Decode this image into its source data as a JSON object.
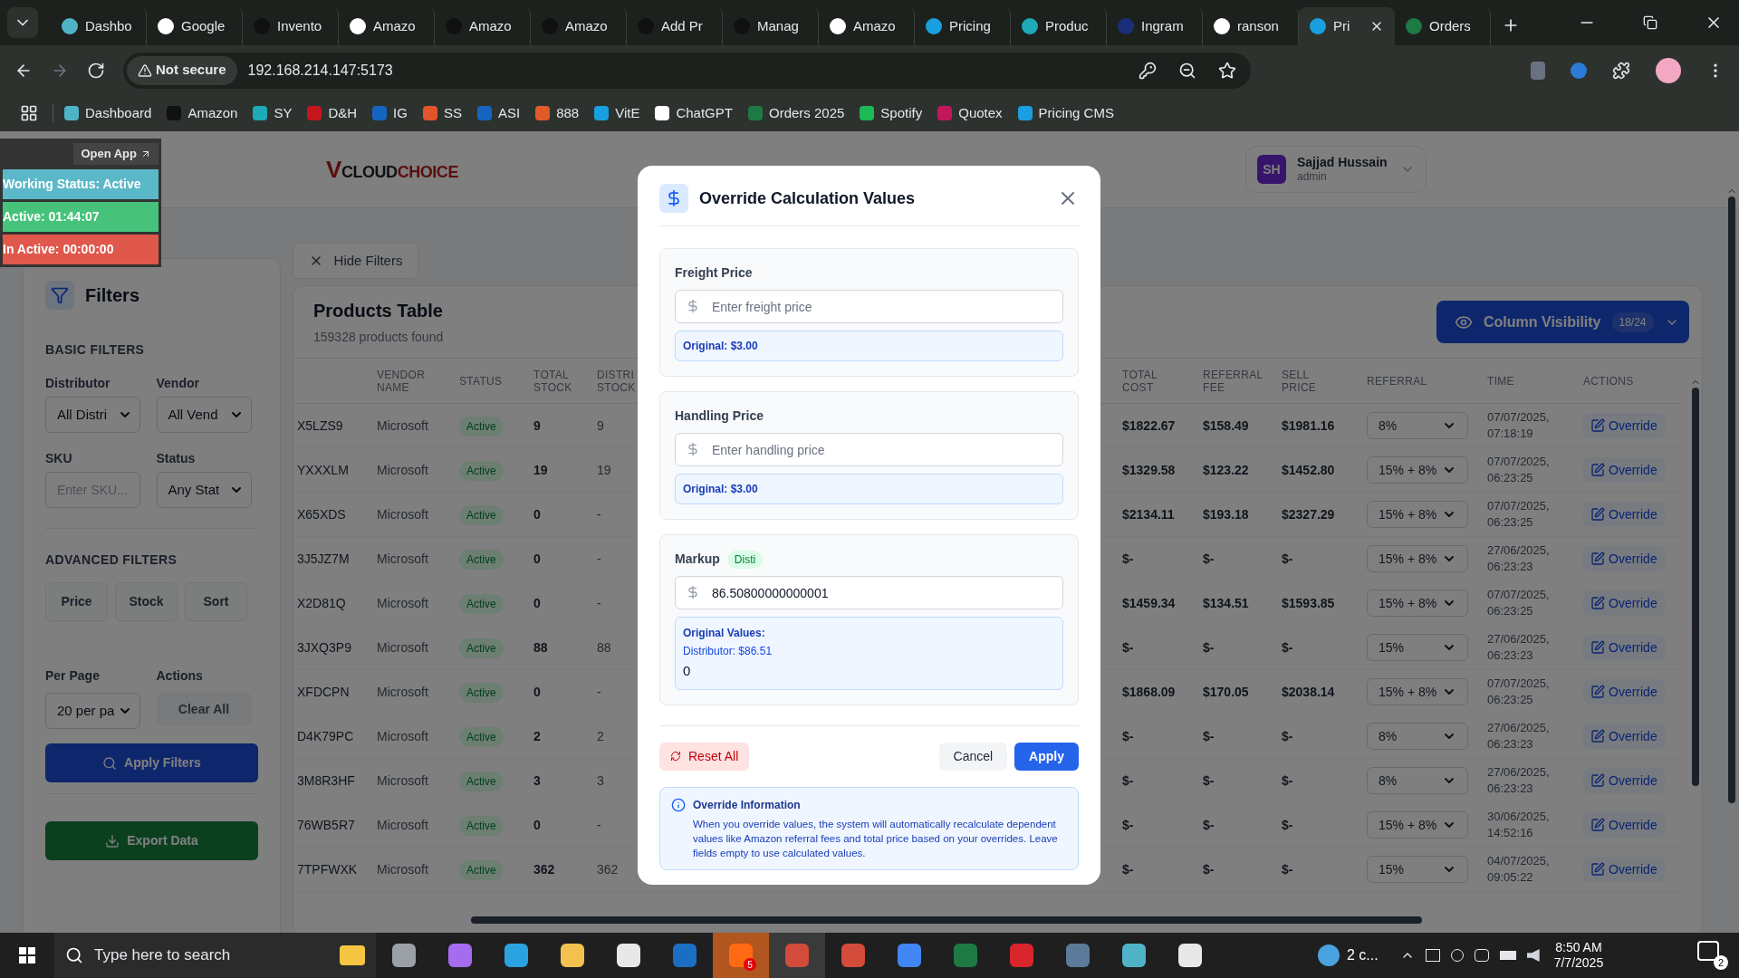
{
  "browser": {
    "tabs": [
      {
        "title": "Dashbo",
        "selected": false
      },
      {
        "title": "Google",
        "selected": false
      },
      {
        "title": "Invento",
        "selected": false
      },
      {
        "title": "Amazo",
        "selected": false
      },
      {
        "title": "Amazo",
        "selected": false
      },
      {
        "title": "Amazo",
        "selected": false
      },
      {
        "title": "Add Pr",
        "selected": false
      },
      {
        "title": "Manag",
        "selected": false
      },
      {
        "title": "Amazo",
        "selected": false
      },
      {
        "title": "Pricing",
        "selected": false
      },
      {
        "title": "Produc",
        "selected": false
      },
      {
        "title": "Ingram",
        "selected": false
      },
      {
        "title": "ranson",
        "selected": false
      },
      {
        "title": "Pri",
        "selected": true
      },
      {
        "title": "Orders",
        "selected": false
      }
    ],
    "security": "Not secure",
    "url": "192.168.214.147:5173",
    "bookmarks": [
      "Dashboard",
      "Amazon",
      "SY",
      "D&H",
      "IG",
      "SS",
      "ASI",
      "888",
      "VitE",
      "ChatGPT",
      "Orders 2025",
      "Spotify",
      "Quotex",
      "Pricing CMS"
    ]
  },
  "status_widget": {
    "open_app": "Open App",
    "working_status": "Working Status: Active",
    "active": "Active: 01:44:07",
    "inactive": "In Active: 00:00:00"
  },
  "header": {
    "logo": [
      "V",
      "CLOUD",
      "CHOICE"
    ],
    "user": {
      "initials": "SH",
      "name": "Sajjad Hussain",
      "role": "admin"
    }
  },
  "filters": {
    "title": "Filters",
    "basic_title": "BASIC FILTERS",
    "distributor": {
      "label": "Distributor",
      "value": "All Distri"
    },
    "vendor": {
      "label": "Vendor",
      "value": "All Vend"
    },
    "sku": {
      "label": "SKU",
      "placeholder": "Enter SKU..."
    },
    "status": {
      "label": "Status",
      "value": "Any Stat"
    },
    "advanced_title": "ADVANCED FILTERS",
    "advanced_buttons": [
      "Price",
      "Stock",
      "Sort"
    ],
    "per_page": {
      "label": "Per Page",
      "value": "20 per pa"
    },
    "actions_label": "Actions",
    "clear_all": "Clear All",
    "apply": "Apply Filters",
    "export": "Export Data"
  },
  "hide_filters": "Hide Filters",
  "table": {
    "title": "Products Table",
    "count": "159328 products found",
    "column_visibility": {
      "label": "Column Visibility",
      "badge": "18/24"
    },
    "columns": [
      "",
      "VENDOR NAME",
      "STATUS",
      "TOTAL STOCK",
      "DISTRI STOCK",
      "TOTAL COST",
      "REFERRAL FEE",
      "SELL PRICE",
      "REFERRAL",
      "TIME",
      "ACTIONS"
    ],
    "rows": [
      {
        "sku": "X5LZS9",
        "vendor": "Microsoft",
        "status": "Active",
        "total_stock": "9",
        "distri_stock": "9",
        "total_cost": "$1822.67",
        "referral_fee": "$158.49",
        "sell_price": "$1981.16",
        "referral": "8%",
        "time": "07/07/2025, 07:18:19",
        "action": "Override"
      },
      {
        "sku": "YXXXLM",
        "vendor": "Microsoft",
        "status": "Active",
        "total_stock": "19",
        "distri_stock": "19",
        "total_cost": "$1329.58",
        "referral_fee": "$123.22",
        "sell_price": "$1452.80",
        "referral": "15% + 8%",
        "time": "07/07/2025, 06:23:25",
        "action": "Override"
      },
      {
        "sku": "X65XDS",
        "vendor": "Microsoft",
        "status": "Active",
        "total_stock": "0",
        "distri_stock": "-",
        "total_cost": "$2134.11",
        "referral_fee": "$193.18",
        "sell_price": "$2327.29",
        "referral": "15% + 8%",
        "time": "07/07/2025, 06:23:25",
        "action": "Override"
      },
      {
        "sku": "3J5JZ7M",
        "vendor": "Microsoft",
        "status": "Active",
        "total_stock": "0",
        "distri_stock": "-",
        "total_cost": "$-",
        "referral_fee": "$-",
        "sell_price": "$-",
        "referral": "15% + 8%",
        "time": "27/06/2025, 06:23:23",
        "action": "Override"
      },
      {
        "sku": "X2D81Q",
        "vendor": "Microsoft",
        "status": "Active",
        "total_stock": "0",
        "distri_stock": "-",
        "total_cost": "$1459.34",
        "referral_fee": "$134.51",
        "sell_price": "$1593.85",
        "referral": "15% + 8%",
        "time": "07/07/2025, 06:23:25",
        "action": "Override"
      },
      {
        "sku": "3JXQ3P9",
        "vendor": "Microsoft",
        "status": "Active",
        "total_stock": "88",
        "distri_stock": "88",
        "total_cost": "$-",
        "referral_fee": "$-",
        "sell_price": "$-",
        "referral": "15%",
        "time": "27/06/2025, 06:23:23",
        "action": "Override"
      },
      {
        "sku": "XFDCPN",
        "vendor": "Microsoft",
        "status": "Active",
        "total_stock": "0",
        "distri_stock": "-",
        "total_cost": "$1868.09",
        "referral_fee": "$170.05",
        "sell_price": "$2038.14",
        "referral": "15% + 8%",
        "time": "07/07/2025, 06:23:25",
        "action": "Override"
      },
      {
        "sku": "D4K79PC",
        "vendor": "Microsoft",
        "status": "Active",
        "total_stock": "2",
        "distri_stock": "2",
        "total_cost": "$-",
        "referral_fee": "$-",
        "sell_price": "$-",
        "referral": "8%",
        "time": "27/06/2025, 06:23:23",
        "action": "Override"
      },
      {
        "sku": "3M8R3HF",
        "vendor": "Microsoft",
        "status": "Active",
        "total_stock": "3",
        "distri_stock": "3",
        "total_cost": "$-",
        "referral_fee": "$-",
        "sell_price": "$-",
        "referral": "8%",
        "time": "27/06/2025, 06:23:23",
        "action": "Override"
      },
      {
        "sku": "76WB5R7",
        "vendor": "Microsoft",
        "status": "Active",
        "total_stock": "0",
        "distri_stock": "-",
        "total_cost": "$-",
        "referral_fee": "$-",
        "sell_price": "$-",
        "referral": "15% + 8%",
        "time": "30/06/2025, 14:52:16",
        "action": "Override"
      },
      {
        "sku": "7TPFWXK",
        "vendor": "Microsoft",
        "status": "Active",
        "total_stock": "362",
        "distri_stock": "362",
        "total_cost": "$-",
        "referral_fee": "$-",
        "sell_price": "$-",
        "referral": "15%",
        "time": "04/07/2025, 09:05:22",
        "action": "Override"
      }
    ]
  },
  "modal": {
    "title": "Override Calculation Values",
    "sections": [
      {
        "kind": "price",
        "label": "Freight Price",
        "placeholder": "Enter freight price",
        "original": "Original: $3.00"
      },
      {
        "kind": "price",
        "label": "Handling Price",
        "placeholder": "Enter handling price",
        "original": "Original: $3.00"
      },
      {
        "kind": "markup",
        "label": "Markup",
        "badge": "Disti",
        "value": "86.50800000000001",
        "original_title": "Original Values:",
        "original_line": "Distributor: $86.51",
        "extra": "0"
      }
    ],
    "reset": "Reset All",
    "cancel": "Cancel",
    "apply": "Apply",
    "info": {
      "title": "Override Information",
      "text": "When you override values, the system will automatically recalculate dependent values like Amazon referral fees and total price based on your overrides. Leave fields empty to use calculated values."
    }
  },
  "taskbar": {
    "search_placeholder": "Type here to search",
    "badge": "5",
    "weather": "2 c...",
    "time": "8:50 AM",
    "date": "7/7/2025",
    "notifications": "2"
  }
}
